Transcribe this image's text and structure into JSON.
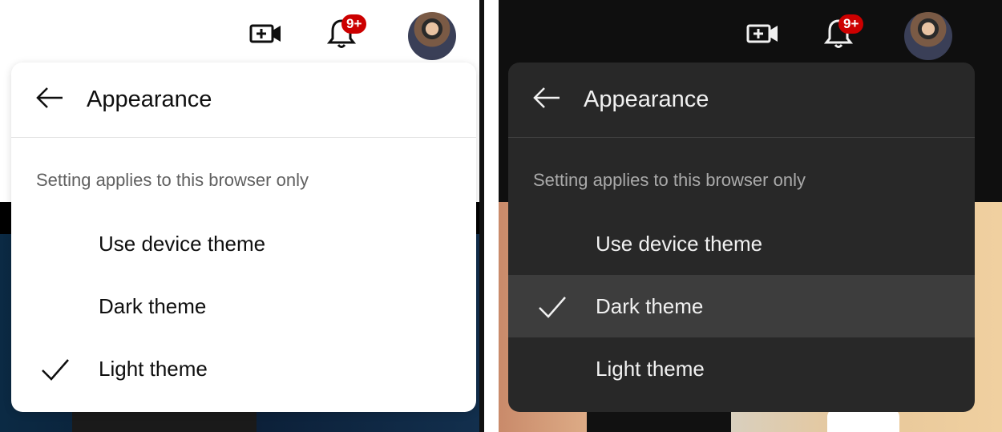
{
  "header": {
    "notifications_badge": "9+",
    "create_icon": "video-camera-plus-icon",
    "bell_icon": "bell-icon"
  },
  "menu": {
    "title": "Appearance",
    "note": "Setting applies to this browser only",
    "options": [
      {
        "label": "Use device theme"
      },
      {
        "label": "Dark theme"
      },
      {
        "label": "Light theme"
      }
    ]
  },
  "panels": {
    "light": {
      "selected": "Light theme"
    },
    "dark": {
      "selected": "Dark theme"
    }
  },
  "colors": {
    "badge": "#cc0000",
    "light_menu_bg": "#ffffff",
    "dark_menu_bg": "#282828",
    "dark_selected_row": "#3d3d3d"
  }
}
